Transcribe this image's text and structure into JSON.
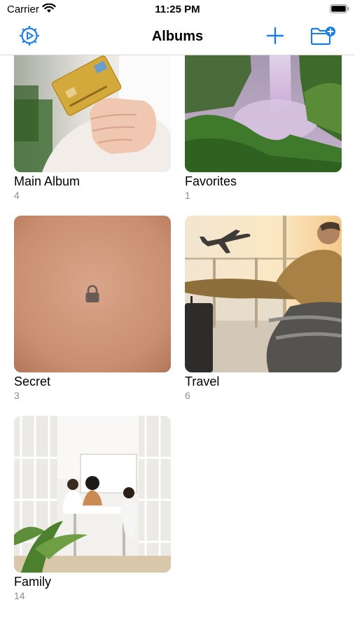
{
  "status": {
    "carrier": "Carrier",
    "time": "11:25 PM"
  },
  "nav": {
    "title": "Albums"
  },
  "albums": [
    {
      "title": "Main Album",
      "count": "4"
    },
    {
      "title": "Favorites",
      "count": "1"
    },
    {
      "title": "Secret",
      "count": "3"
    },
    {
      "title": "Travel",
      "count": "6"
    },
    {
      "title": "Family",
      "count": "14"
    }
  ],
  "icons": {
    "settings": "gear-play-icon",
    "add": "plus-icon",
    "new_folder": "folder-plus-icon",
    "lock": "lock-icon"
  },
  "colors": {
    "accent": "#1b7ee6",
    "secondary_text": "#8e8e93"
  }
}
